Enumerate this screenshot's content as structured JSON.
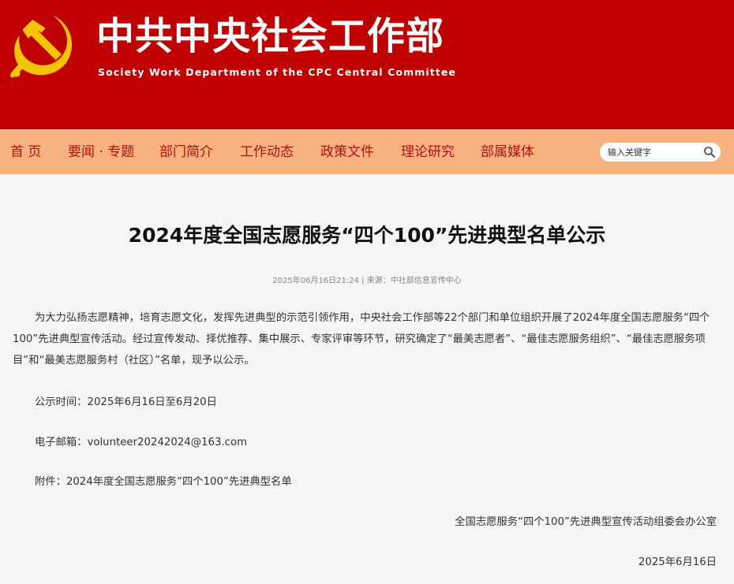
{
  "header": {
    "title": "中共中央社会工作部",
    "subtitle": "Society Work Department of the CPC Central Committee",
    "emblem_color": "#f5c400",
    "background": "#c00000",
    "emblem_icon": "hammer-and-sickle-icon"
  },
  "nav": {
    "items": [
      {
        "label": "首 页"
      },
      {
        "label": "要闻 · 专题"
      },
      {
        "label": "部门简介"
      },
      {
        "label": "工作动态"
      },
      {
        "label": "政策文件"
      },
      {
        "label": "理论研究"
      },
      {
        "label": "部属媒体"
      }
    ],
    "search_placeholder": "输入关键字",
    "search_icon": "search-icon"
  },
  "article": {
    "title": "2024年度全国志愿服务“四个100”先进典型名单公示",
    "meta": "2025年06月16日21:24 | 来源：中社部信息宣传中心",
    "body": "为大力弘扬志愿精神，培育志愿文化，发挥先进典型的示范引领作用，中央社会工作部等22个部门和单位组织开展了2024年度全国志愿服务“四个100”先进典型宣传活动。经过宣传发动、择优推荐、集中展示、专家评审等环节，研究确定了“最美志愿者”、“最佳志愿服务组织”、“最佳志愿服务项目”和“最美志愿服务村（社区）”名单，现予以公示。",
    "notice_time": "公示时间：2025年6月16日至6月20日",
    "email": "电子邮箱：volunteer20242024@163.com",
    "attachment": "附件：2024年度全国志愿服务“四个100”先进典型名单",
    "signature": "全国志愿服务“四个100”先进典型宣传活动组委会办公室",
    "date": "2025年6月16日"
  }
}
